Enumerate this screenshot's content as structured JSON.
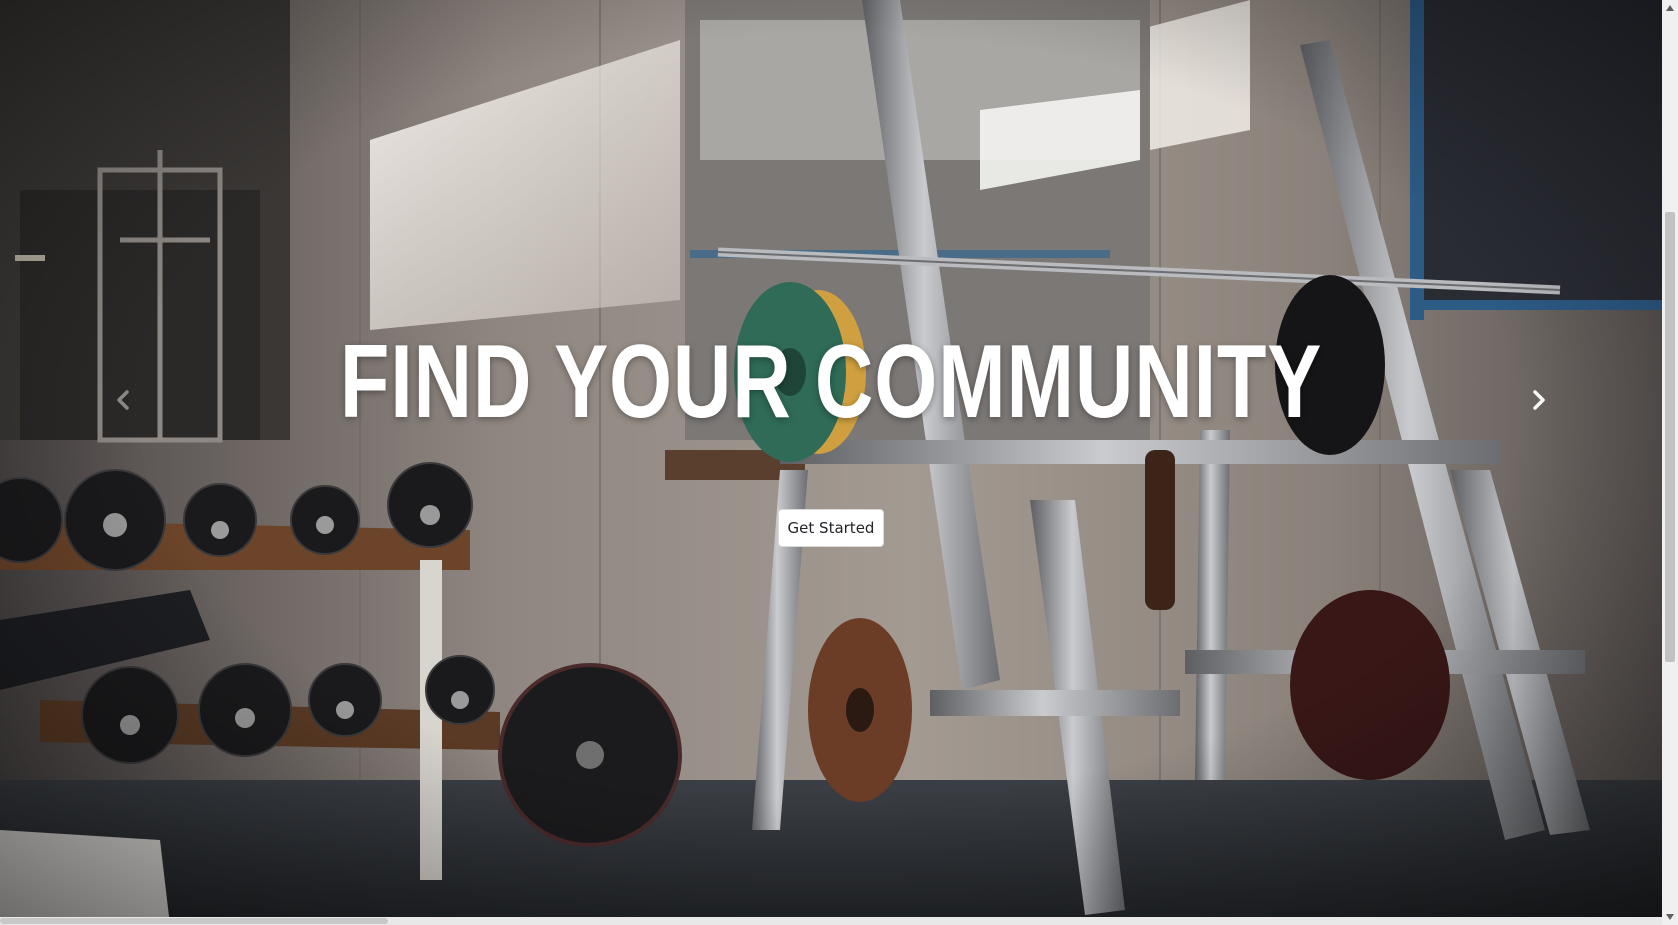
{
  "hero": {
    "headline": "FIND YOUR COMMUNITY",
    "cta_label": "Get Started",
    "background": "gym-photo-barbell-rack-dumbbells"
  },
  "carousel": {
    "prev_icon": "chevron-left-icon",
    "next_icon": "chevron-right-icon"
  },
  "scrollbars": {
    "up_icon": "triangle-up-icon",
    "down_icon": "triangle-down-icon"
  },
  "colors": {
    "headline": "#ffffff",
    "button_bg": "#ffffff",
    "button_text": "#212529"
  }
}
